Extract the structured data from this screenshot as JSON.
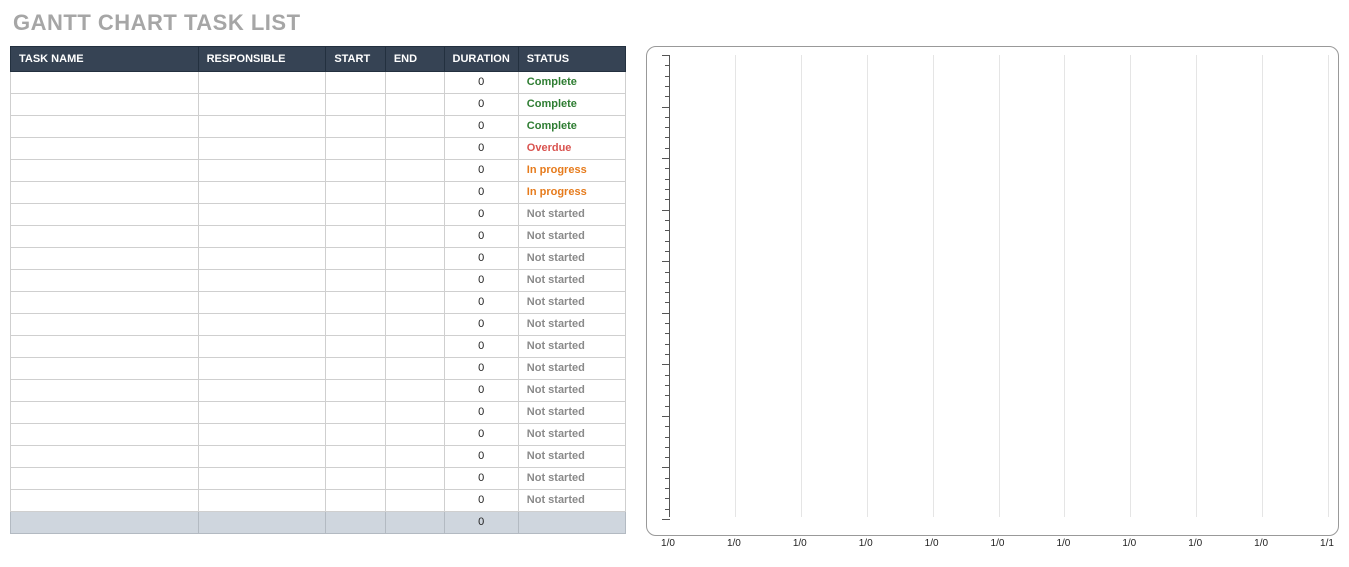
{
  "title": "GANTT CHART TASK LIST",
  "headers": {
    "task": "TASK NAME",
    "responsible": "RESPONSIBLE",
    "start": "START",
    "end": "END",
    "duration": "DURATION",
    "status": "STATUS"
  },
  "rows": [
    {
      "task": "",
      "responsible": "",
      "start": "",
      "end": "",
      "duration": "0",
      "status": "Complete"
    },
    {
      "task": "",
      "responsible": "",
      "start": "",
      "end": "",
      "duration": "0",
      "status": "Complete"
    },
    {
      "task": "",
      "responsible": "",
      "start": "",
      "end": "",
      "duration": "0",
      "status": "Complete"
    },
    {
      "task": "",
      "responsible": "",
      "start": "",
      "end": "",
      "duration": "0",
      "status": "Overdue"
    },
    {
      "task": "",
      "responsible": "",
      "start": "",
      "end": "",
      "duration": "0",
      "status": "In progress"
    },
    {
      "task": "",
      "responsible": "",
      "start": "",
      "end": "",
      "duration": "0",
      "status": "In progress"
    },
    {
      "task": "",
      "responsible": "",
      "start": "",
      "end": "",
      "duration": "0",
      "status": "Not started"
    },
    {
      "task": "",
      "responsible": "",
      "start": "",
      "end": "",
      "duration": "0",
      "status": "Not started"
    },
    {
      "task": "",
      "responsible": "",
      "start": "",
      "end": "",
      "duration": "0",
      "status": "Not started"
    },
    {
      "task": "",
      "responsible": "",
      "start": "",
      "end": "",
      "duration": "0",
      "status": "Not started"
    },
    {
      "task": "",
      "responsible": "",
      "start": "",
      "end": "",
      "duration": "0",
      "status": "Not started"
    },
    {
      "task": "",
      "responsible": "",
      "start": "",
      "end": "",
      "duration": "0",
      "status": "Not started"
    },
    {
      "task": "",
      "responsible": "",
      "start": "",
      "end": "",
      "duration": "0",
      "status": "Not started"
    },
    {
      "task": "",
      "responsible": "",
      "start": "",
      "end": "",
      "duration": "0",
      "status": "Not started"
    },
    {
      "task": "",
      "responsible": "",
      "start": "",
      "end": "",
      "duration": "0",
      "status": "Not started"
    },
    {
      "task": "",
      "responsible": "",
      "start": "",
      "end": "",
      "duration": "0",
      "status": "Not started"
    },
    {
      "task": "",
      "responsible": "",
      "start": "",
      "end": "",
      "duration": "0",
      "status": "Not started"
    },
    {
      "task": "",
      "responsible": "",
      "start": "",
      "end": "",
      "duration": "0",
      "status": "Not started"
    },
    {
      "task": "",
      "responsible": "",
      "start": "",
      "end": "",
      "duration": "0",
      "status": "Not started"
    },
    {
      "task": "",
      "responsible": "",
      "start": "",
      "end": "",
      "duration": "0",
      "status": "Not started"
    }
  ],
  "total": {
    "task": "",
    "responsible": "",
    "start": "",
    "end": "",
    "duration": "0",
    "status": ""
  },
  "chart_data": {
    "type": "bar",
    "title": "",
    "xlabel": "",
    "ylabel": "",
    "x_ticks": [
      "1/0",
      "1/0",
      "1/0",
      "1/0",
      "1/0",
      "1/0",
      "1/0",
      "1/0",
      "1/0",
      "1/0",
      "1/1"
    ],
    "y_major_ticks": 9,
    "y_minor_per_major": 5,
    "series": []
  }
}
